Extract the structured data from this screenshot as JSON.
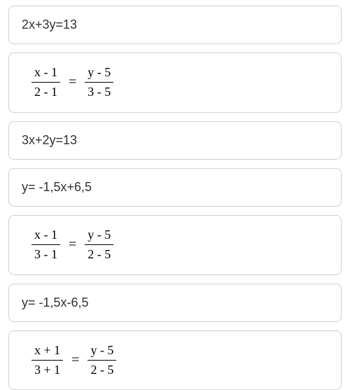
{
  "cards": [
    {
      "type": "partial"
    },
    {
      "type": "simple",
      "text": "2x+3y=13"
    },
    {
      "type": "fraction",
      "left_num": "x - 1",
      "left_den": "2 - 1",
      "right_num": "y - 5",
      "right_den": "3 - 5"
    },
    {
      "type": "simple",
      "text": "3x+2y=13"
    },
    {
      "type": "simple",
      "text": "y= -1,5x+6,5"
    },
    {
      "type": "fraction",
      "left_num": "x - 1",
      "left_den": "3 - 1",
      "right_num": "y - 5",
      "right_den": "2 - 5"
    },
    {
      "type": "simple",
      "text": "y= -1,5x-6,5"
    },
    {
      "type": "fraction",
      "left_num": "x + 1",
      "left_den": "3 + 1",
      "right_num": "y - 5",
      "right_den": "2 - 5"
    }
  ],
  "equals": "="
}
